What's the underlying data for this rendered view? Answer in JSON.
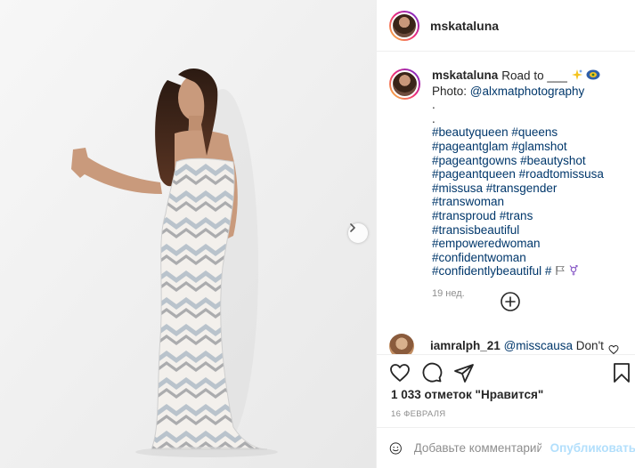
{
  "post": {
    "username": "mskataluna",
    "caption": {
      "text": "Road to ___",
      "photo_credit_prefix": "Photo: ",
      "photo_credit_mention": "@alxmatphotography",
      "dot1": ".",
      "dot2": ".",
      "hashtag_lines": [
        "#beautyqueen #queens",
        "#pageantglam #glamshot",
        "#pageantgowns #beautyshot",
        "#pageantqueen #roadtomissusa",
        "#missusa #transgender #transwoman",
        "#transproud #trans #transisbeautiful",
        "#empoweredwoman",
        "#confidentwoman",
        "#confidentlybeautiful #"
      ],
      "time": "19 нед."
    },
    "comment": {
      "username": "iamralph_21",
      "mention": "@misscausa",
      "text": " Don't"
    },
    "likes": "1 033 отметок \"Нравится\"",
    "date": "16 ФЕВРАЛЯ",
    "add_comment": {
      "placeholder": "Добавьте комментарий...",
      "publish_label": "Опубликовать"
    }
  },
  "icons": {
    "next": "chevron-right-icon",
    "load_more": "plus-circle-icon",
    "like": "heart-icon",
    "comment": "comment-bubble-icon",
    "share": "paper-plane-icon",
    "save": "bookmark-icon",
    "emoji": "smiley-icon"
  },
  "colors": {
    "link": "#00376b",
    "secondary_text": "#8e8e8e",
    "publish_disabled": "#b2dffc",
    "border": "#efefef"
  }
}
